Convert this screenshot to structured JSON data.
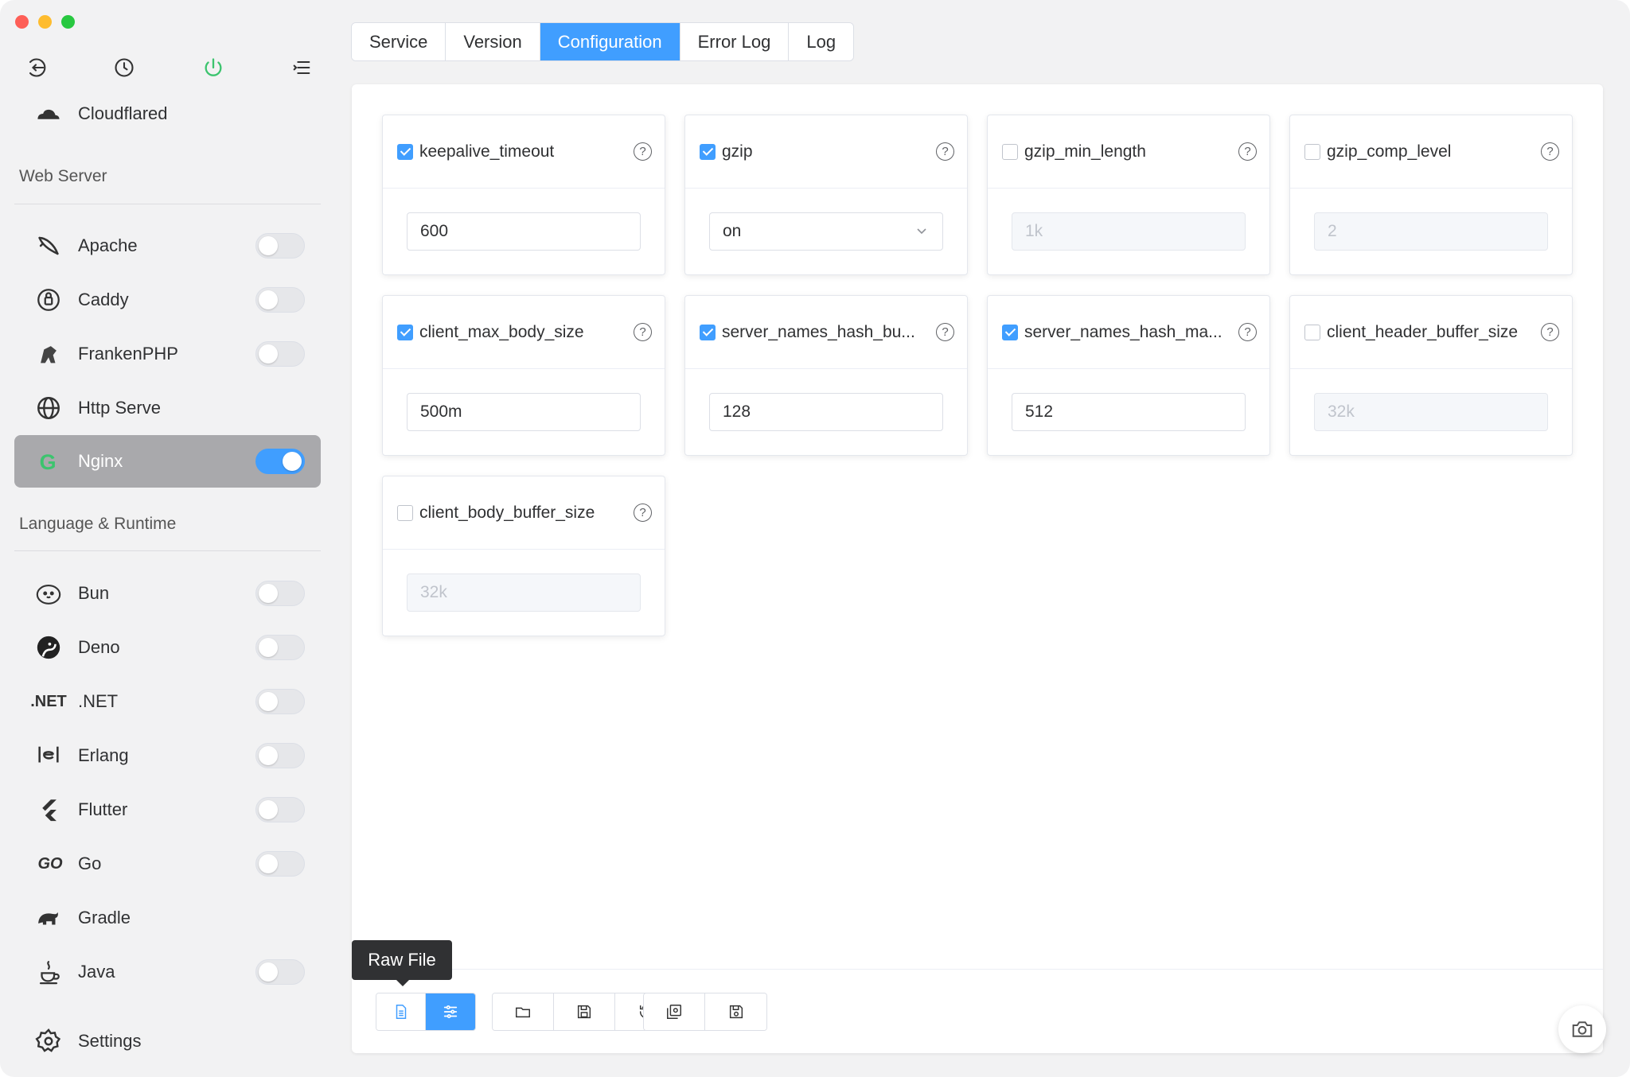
{
  "tabs": [
    "Service",
    "Version",
    "Configuration",
    "Error Log",
    "Log"
  ],
  "active_tab": "Configuration",
  "sidebar": {
    "top_item": {
      "label": "Cloudflared",
      "icon": "cloud-icon"
    },
    "web_server_title": "Web Server",
    "web_servers": [
      {
        "label": "Apache",
        "icon": "apache-feather-icon",
        "enabled": false
      },
      {
        "label": "Caddy",
        "icon": "caddy-icon",
        "enabled": false
      },
      {
        "label": "FrankenPHP",
        "icon": "frankenphp-icon",
        "enabled": false
      },
      {
        "label": "Http Serve",
        "icon": "globe-icon",
        "enabled": null
      },
      {
        "label": "Nginx",
        "icon": "nginx-icon",
        "enabled": true
      }
    ],
    "runtime_title": "Language & Runtime",
    "runtimes": [
      {
        "label": "Bun",
        "icon": "bun-icon",
        "enabled": false
      },
      {
        "label": "Deno",
        "icon": "deno-icon",
        "enabled": false
      },
      {
        "label": ".NET",
        "icon_text": ".NET",
        "icon": "dotnet-icon",
        "enabled": false
      },
      {
        "label": "Erlang",
        "icon": "erlang-icon",
        "enabled": false
      },
      {
        "label": "Flutter",
        "icon": "flutter-icon",
        "enabled": false
      },
      {
        "label": "Go",
        "icon_text": "GO",
        "icon": "go-icon",
        "enabled": false
      },
      {
        "label": "Gradle",
        "icon": "gradle-elephant-icon",
        "enabled": null
      },
      {
        "label": "Java",
        "icon": "java-cup-icon",
        "enabled": false
      }
    ],
    "settings_label": "Settings"
  },
  "config_cards": [
    {
      "name": "keepalive_timeout",
      "checked": true,
      "type": "input",
      "value": "600"
    },
    {
      "name": "gzip",
      "checked": true,
      "type": "select",
      "value": "on"
    },
    {
      "name": "gzip_min_length",
      "checked": false,
      "type": "input",
      "value": "1k"
    },
    {
      "name": "gzip_comp_level",
      "checked": false,
      "type": "input",
      "value": "2"
    },
    {
      "name": "client_max_body_size",
      "checked": true,
      "type": "input",
      "value": "500m"
    },
    {
      "name": "server_names_hash_bu...",
      "checked": true,
      "type": "input",
      "value": "128"
    },
    {
      "name": "server_names_hash_ma...",
      "checked": true,
      "type": "input",
      "value": "512"
    },
    {
      "name": "client_header_buffer_size",
      "checked": false,
      "type": "input",
      "value": "32k"
    },
    {
      "name": "client_body_buffer_size",
      "checked": false,
      "type": "input",
      "value": "32k"
    }
  ],
  "tooltip": "Raw File",
  "colors": {
    "accent": "#409eff",
    "active_sidebar": "#a9a9ac",
    "power_icon": "#3cc46e"
  }
}
